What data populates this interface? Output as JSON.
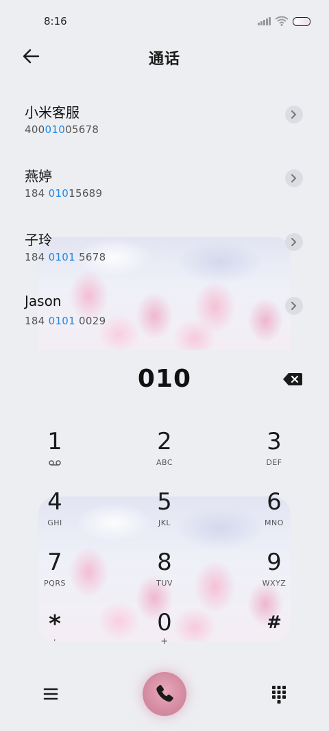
{
  "status_bar": {
    "time": "8:16"
  },
  "header": {
    "title": "通话"
  },
  "contacts": [
    {
      "name": "小米客服",
      "num_pre": "400",
      "num_hl": "010",
      "num_post": "05678"
    },
    {
      "name": "燕婷",
      "num_pre": "184 ",
      "num_hl": "010",
      "num_post": "15689"
    },
    {
      "name": "子玲",
      "num_pre": "184 ",
      "num_hl": "0101",
      "num_post": " 5678"
    },
    {
      "name": "Jason",
      "num_pre": "184 ",
      "num_hl": "0101",
      "num_post": " 0029"
    }
  ],
  "dialer": {
    "entry": "010",
    "keys": [
      {
        "digit": "1",
        "letters": ""
      },
      {
        "digit": "2",
        "letters": "ABC"
      },
      {
        "digit": "3",
        "letters": "DEF"
      },
      {
        "digit": "4",
        "letters": "GHI"
      },
      {
        "digit": "5",
        "letters": "JKL"
      },
      {
        "digit": "6",
        "letters": "MNO"
      },
      {
        "digit": "7",
        "letters": "PQRS"
      },
      {
        "digit": "8",
        "letters": "TUV"
      },
      {
        "digit": "9",
        "letters": "WXYZ"
      },
      {
        "digit": "*",
        "letters": ","
      },
      {
        "digit": "0",
        "letters": "+"
      },
      {
        "digit": "#",
        "letters": ""
      }
    ]
  },
  "colors": {
    "highlight": "#1e88e5",
    "call_button": "#d48ba2",
    "background": "#edeef2"
  },
  "icons": {
    "back": "arrow-left-icon",
    "chevron": "chevron-right-icon",
    "backspace": "backspace-icon",
    "voicemail": "voicemail-icon",
    "menu": "menu-icon",
    "call": "phone-icon",
    "keypad": "keypad-icon"
  }
}
